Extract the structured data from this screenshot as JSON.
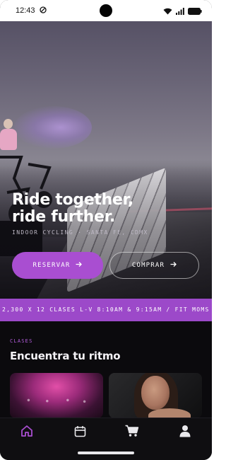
{
  "status_bar": {
    "time": "12:43"
  },
  "hero": {
    "title_line1": "Ride together,",
    "title_line2": "ride further.",
    "subtitle": "INDOOR CYCLING · SANTA FE, CDMX",
    "primary_button_label": "RESERVAR",
    "secondary_button_label": "COMPRAR"
  },
  "ticker": {
    "text": "2,300 X 12 CLASES L-V 8:10AM & 9:15AM  /  FIT MOMS"
  },
  "classes": {
    "eyebrow": "CLASES",
    "title": "Encuentra tu ritmo"
  },
  "bottom_nav": {
    "items": [
      {
        "icon": "home-icon",
        "active": true
      },
      {
        "icon": "calendar-icon",
        "active": false
      },
      {
        "icon": "cart-icon",
        "active": false
      },
      {
        "icon": "profile-icon",
        "active": false
      }
    ]
  },
  "colors": {
    "accent": "#a94ed1",
    "ticker": "#9c49c9",
    "background": "#0b0a0d",
    "nav_active": "#a94ed1",
    "nav_inactive": "#e9e8ec"
  }
}
